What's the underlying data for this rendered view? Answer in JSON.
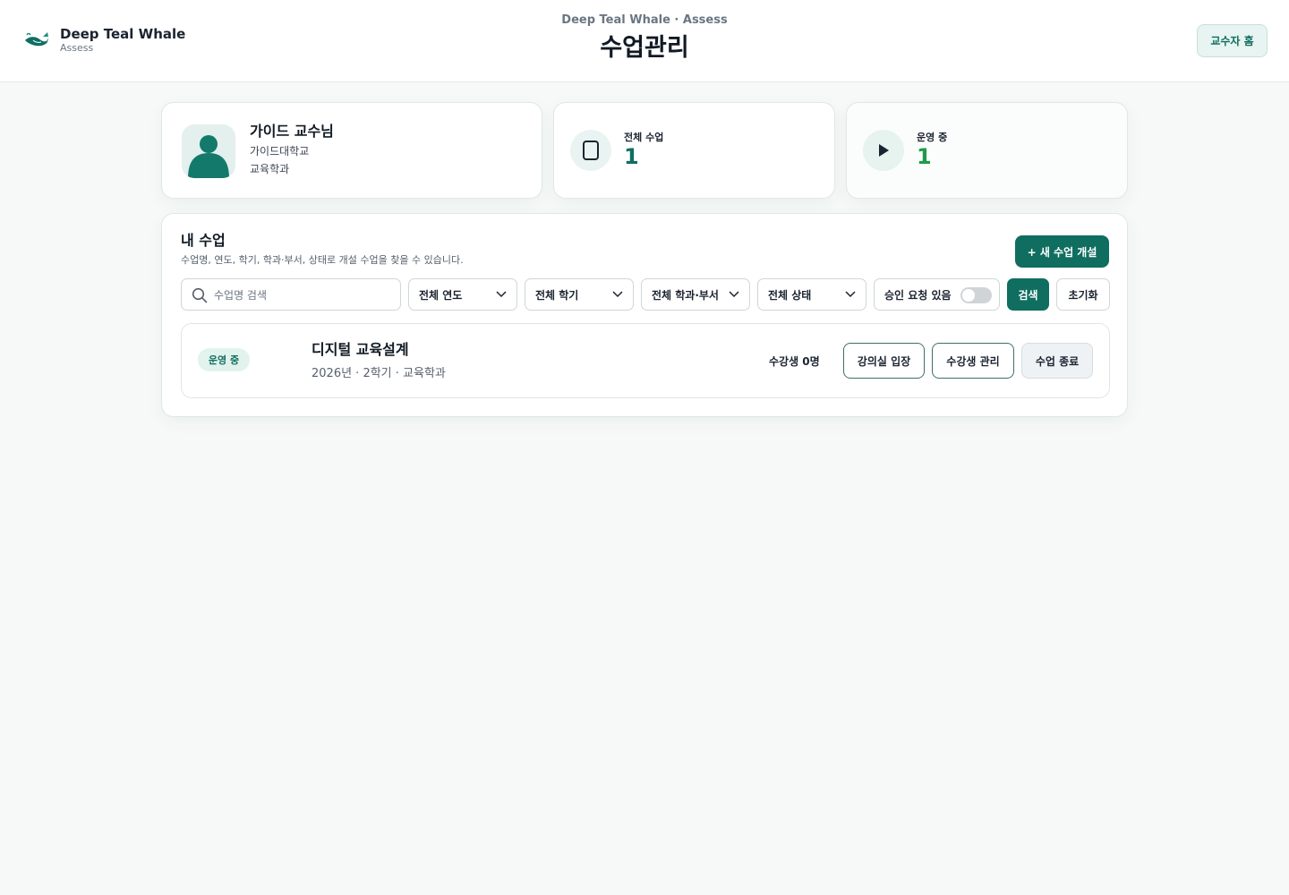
{
  "header": {
    "brand_name": "Deep Teal Whale",
    "brand_sub": "Assess",
    "kicker": "Deep Teal Whale · Assess",
    "title": "수업관리",
    "home_button": "교수자 홈"
  },
  "profile": {
    "name": "가이드 교수님",
    "university": "가이드대학교",
    "department": "교육학과"
  },
  "stats": {
    "total": {
      "label": "전체 수업",
      "value": "1"
    },
    "running": {
      "label": "운영 중",
      "value": "1"
    }
  },
  "panel": {
    "title": "내 수업",
    "description": "수업명, 연도, 학기, 학과·부서, 상태로 개설 수업을 찾을 수 있습니다.",
    "new_button": "+ 새 수업 개설"
  },
  "filters": {
    "search_placeholder": "수업명 검색",
    "year": "전체 연도",
    "semester": "전체 학기",
    "department": "전체 학과·부서",
    "status": "전체 상태",
    "approval_toggle_label": "승인 요청 있음",
    "approval_toggle_on": false,
    "search_button": "검색",
    "reset_button": "초기화"
  },
  "classes": [
    {
      "status": "운영 중",
      "title": "디지털 교육설계",
      "meta": "2026년 · 2학기 · 교육학과",
      "enrollment": "수강생 0명",
      "enter_button": "강의실 입장",
      "manage_button": "수강생 관리",
      "end_button": "수업 종료"
    }
  ],
  "colors": {
    "primary": "#0f6e60",
    "running_green": "#1f9a4a",
    "background": "#f6f9f8"
  }
}
